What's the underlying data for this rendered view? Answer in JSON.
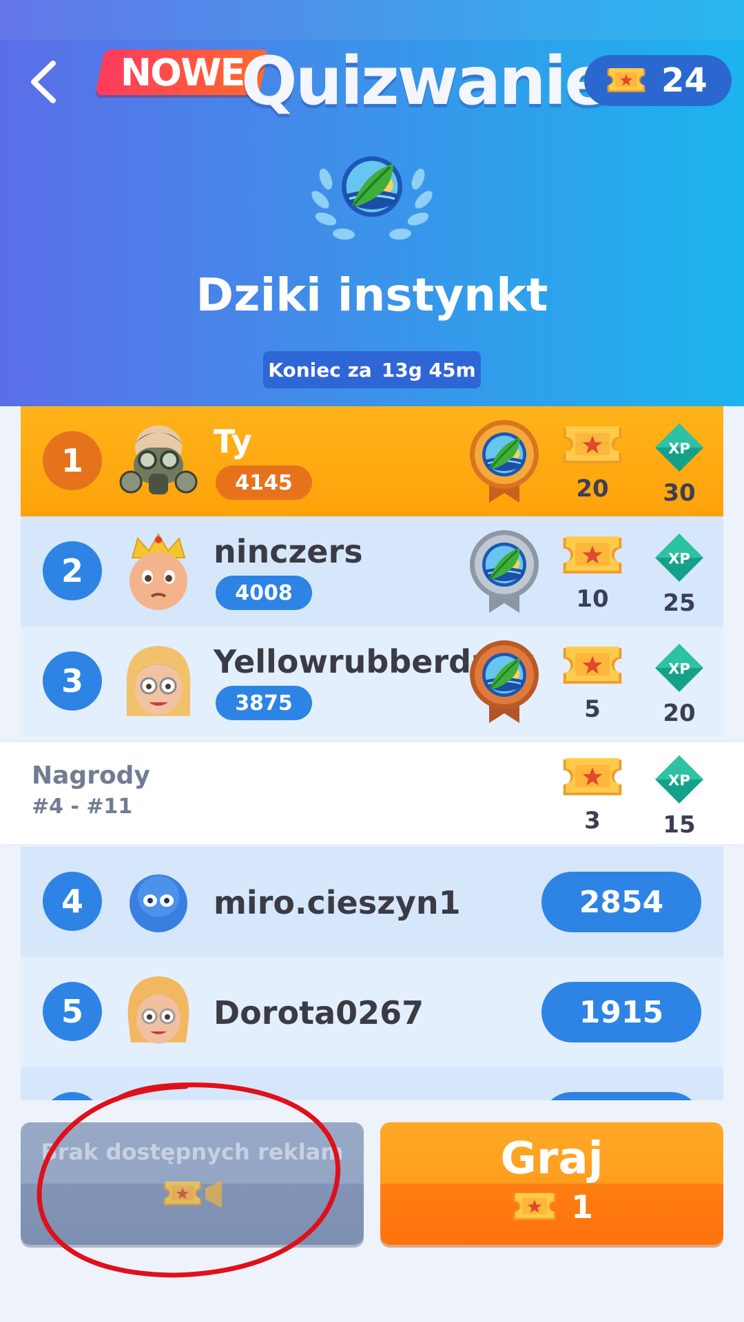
{
  "header": {
    "badge": "NOWE",
    "title": "Quizwanie",
    "tickets": "24",
    "category": "Dziki instynkt",
    "countdown_label": "Koniec za",
    "countdown_value": "13g 45m"
  },
  "leaderboard": [
    {
      "rank": "1",
      "name": "Ty",
      "score": "4145",
      "medal": "gold",
      "tickets": "20",
      "xp": "30"
    },
    {
      "rank": "2",
      "name": "ninczers",
      "score": "4008",
      "medal": "silver",
      "tickets": "10",
      "xp": "25"
    },
    {
      "rank": "3",
      "name": "Yellowrubberduck",
      "score": "3875",
      "medal": "bronze",
      "tickets": "5",
      "xp": "20"
    }
  ],
  "prizes": {
    "label": "Nagrody",
    "range": "#4 - #11",
    "tickets": "3",
    "xp": "15"
  },
  "others": [
    {
      "rank": "4",
      "name": "miro.cieszyn1",
      "score": "2854"
    },
    {
      "rank": "5",
      "name": "Dorota0267",
      "score": "1915"
    }
  ],
  "xp_label": "XP",
  "buttons": {
    "ads_label": "Brak dostępnych reklam",
    "play_label": "Graj",
    "play_cost": "1"
  },
  "colors": {
    "accent_orange": "#ff8a16",
    "accent_blue": "#2d84e4",
    "annotation_red": "#e0101a"
  }
}
